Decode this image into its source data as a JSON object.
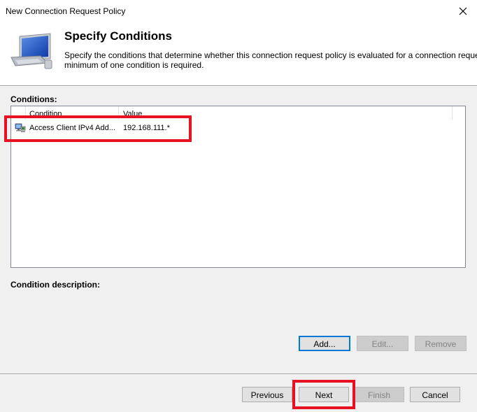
{
  "window": {
    "title": "New Connection Request Policy",
    "close_glyph": "✕"
  },
  "header": {
    "title": "Specify Conditions",
    "description_line1": "Specify the conditions that determine whether this connection request policy is evaluated for a connection request. A",
    "description_line2": "minimum of one condition is required.",
    "icon": "computer-monitor-icon"
  },
  "conditions": {
    "label": "Conditions:",
    "columns": [
      "Condition",
      "Value"
    ],
    "rows": [
      {
        "icon": "network-computer-icon",
        "condition": "Access Client IPv4 Add...",
        "value": "192.168.111.*"
      }
    ]
  },
  "condition_description": {
    "label": "Condition description:"
  },
  "buttons": {
    "add": "Add...",
    "edit": "Edit...",
    "remove": "Remove",
    "previous": "Previous",
    "next": "Next",
    "finish": "Finish",
    "cancel": "Cancel"
  },
  "colors": {
    "highlight": "#e81123",
    "accent": "#0078d7",
    "dialog_background": "#f0f0f0"
  }
}
